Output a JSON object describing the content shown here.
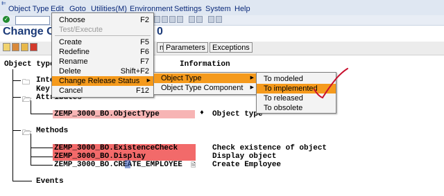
{
  "menubar": {
    "items": [
      "Object Type",
      "Edit",
      "Goto",
      "Utilities(M)",
      "Environment",
      "Settings",
      "System",
      "Help"
    ]
  },
  "page": {
    "title_left": "Change O",
    "title_right": "0"
  },
  "app_toolbar": {
    "buttons": [
      "n",
      "Parameters",
      "Exceptions"
    ],
    "info_label": "Information"
  },
  "edit_menu": {
    "items": [
      {
        "label": "Choose",
        "shortcut": "F2",
        "enabled": true
      },
      {
        "label": "Test/Execute",
        "shortcut": "",
        "enabled": false
      },
      {
        "label": "Create",
        "shortcut": "F5",
        "enabled": true
      },
      {
        "label": "Redefine",
        "shortcut": "F6",
        "enabled": true
      },
      {
        "label": "Rename",
        "shortcut": "F7",
        "enabled": true
      },
      {
        "label": "Delete",
        "shortcut": "Shift+F2",
        "enabled": true
      },
      {
        "label": "Change Release Status",
        "shortcut": "",
        "enabled": true,
        "submenu": true,
        "highlighted": true
      },
      {
        "label": "Cancel",
        "shortcut": "F12",
        "enabled": true
      }
    ]
  },
  "release_submenu": {
    "items": [
      {
        "label": "Object Type",
        "highlighted": true
      },
      {
        "label": "Object Type Component",
        "highlighted": false
      }
    ]
  },
  "status_submenu": {
    "items": [
      {
        "label": "To modeled",
        "highlighted": false
      },
      {
        "label": "To implemented",
        "highlighted": true
      },
      {
        "label": "To released",
        "highlighted": false
      },
      {
        "label": "To obsolete",
        "highlighted": false
      }
    ]
  },
  "tree": {
    "root": "Object type",
    "interfaces": "Inte",
    "key": "Key",
    "attributes": "Attributes",
    "attribute_item": "ZEMP_3000_BO.ObjectType",
    "attribute_desc": "Object type",
    "methods": "Methods",
    "method_items": [
      {
        "name": "ZEMP_3000_BO.ExistenceCheck",
        "desc": "Check existence of object",
        "highlight": "red"
      },
      {
        "name": "ZEMP_3000_BO.Display",
        "desc": "Display object",
        "highlight": "red"
      },
      {
        "name": "ZEMP_3000_BO.CREATE_EMPLOYEE",
        "desc": "Create Employee",
        "highlight": "none"
      }
    ],
    "events": "Events"
  },
  "colors": {
    "menu_highlight": "#f59a1c",
    "row_highlight_red": "#f26a6a",
    "row_highlight_pink": "#f7b4b4",
    "annotation": "#c8102e"
  }
}
